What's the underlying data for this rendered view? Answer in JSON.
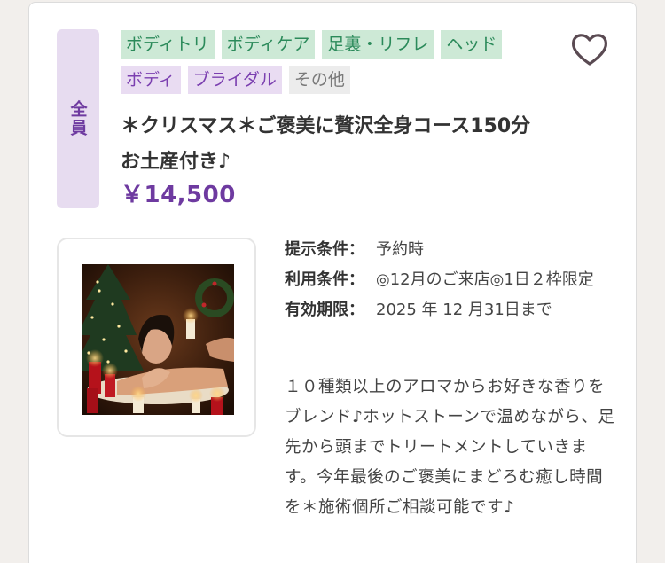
{
  "badge": "全員",
  "tags": [
    {
      "label": "ボディトリ",
      "kind": "green"
    },
    {
      "label": "ボディケア",
      "kind": "green"
    },
    {
      "label": "足裏・リフレ",
      "kind": "green"
    },
    {
      "label": "ヘッド",
      "kind": "green"
    },
    {
      "label": "ボディ",
      "kind": "purple"
    },
    {
      "label": "ブライダル",
      "kind": "purple"
    },
    {
      "label": "その他",
      "kind": "gray"
    }
  ],
  "favorite_icon": "heart-outline-icon",
  "title": "＊クリスマス＊ご褒美に贅沢全身コース150分　お土産付き♪",
  "price": "￥14,500",
  "conditions": [
    {
      "key": "提示条件：",
      "value": "予約時"
    },
    {
      "key": "利用条件：",
      "value": "◎12月のご来店◎1日２枠限定"
    },
    {
      "key": "有効期限：",
      "value": "2025 年 12 月31日まで"
    }
  ],
  "description": "１０種類以上のアロマからお好きな香りをブレンド♪ホットストーンで温めながら、足先から頭までトリートメントしていきます。今年最後のご褒美にまどろむ癒し時間を＊施術個所ご相談可能です♪",
  "colors": {
    "accent_purple": "#6e3aa0",
    "tag_green_bg": "#cde9d6",
    "tag_purple_bg": "#e9dcf2",
    "tag_gray_bg": "#ececec"
  }
}
